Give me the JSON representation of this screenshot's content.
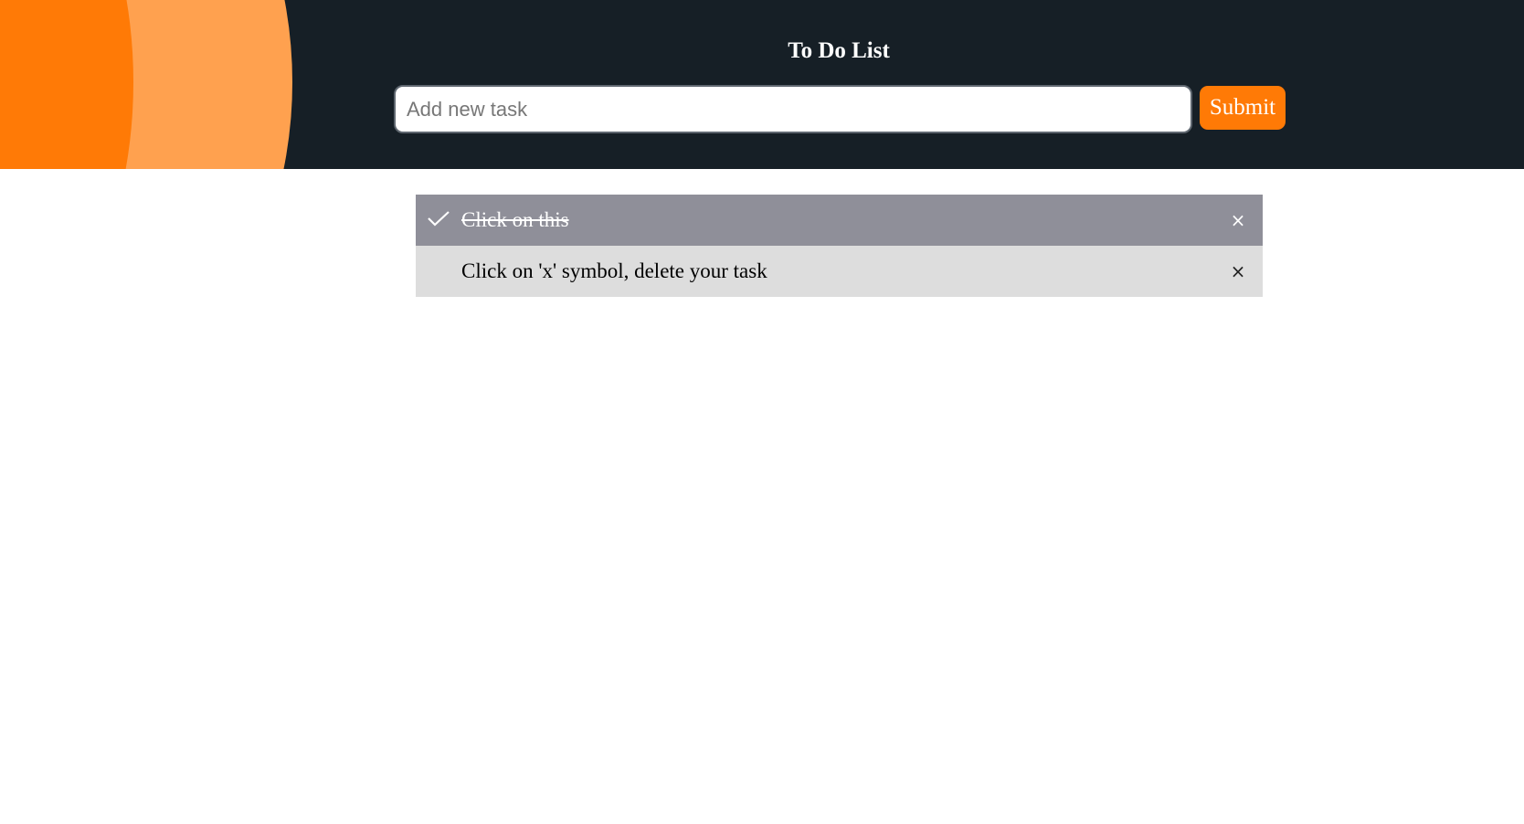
{
  "header": {
    "title": "To Do List",
    "input_placeholder": "Add new task",
    "input_value": "",
    "submit_label": "Submit"
  },
  "colors": {
    "accent": "#ff7a06",
    "accent_light": "#ffa14f",
    "header_bg": "#161f26",
    "checked_bg": "#8f8f99",
    "unchecked_bg": "#dddddd"
  },
  "tasks": [
    {
      "text": "Click on this",
      "checked": true,
      "check_icon": "checkmark-icon",
      "close_label": "×"
    },
    {
      "text": "Click on 'x' symbol, delete your task",
      "checked": false,
      "close_label": "×"
    }
  ]
}
